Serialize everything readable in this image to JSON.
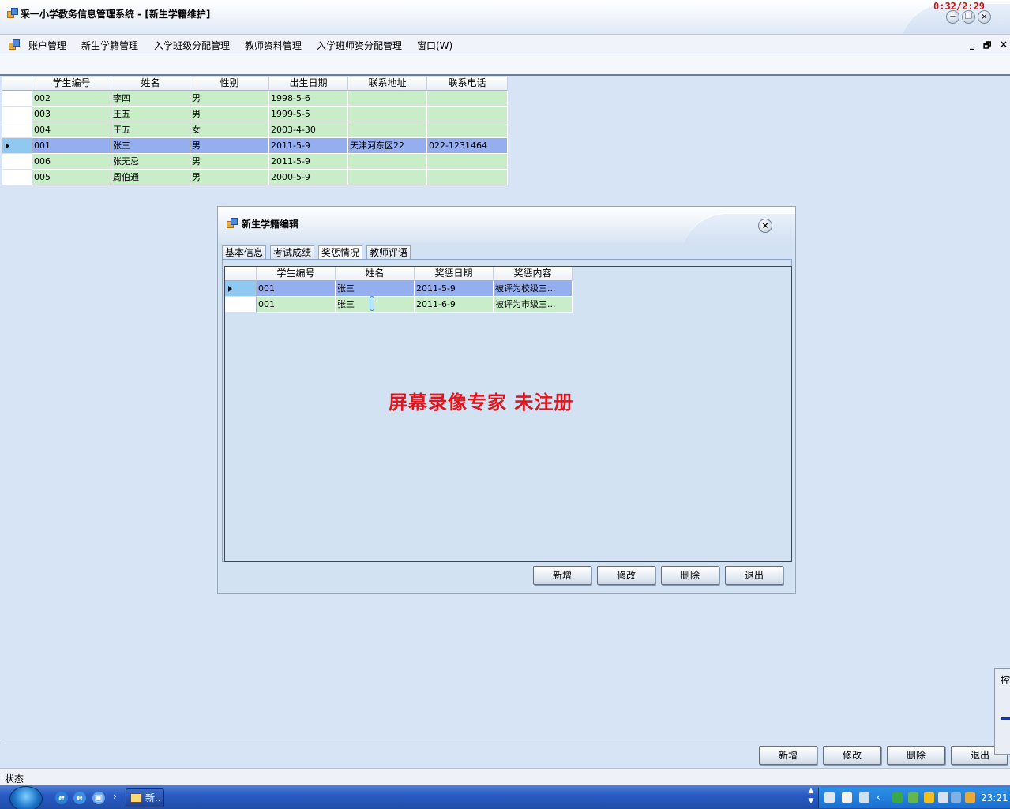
{
  "window": {
    "title": "采一小学教务信息管理系统 - [新生学籍维护]",
    "recorder_time": "0:32/2:29",
    "minimize_glyph": "−",
    "restore_glyph": "❐",
    "close_glyph": "×"
  },
  "menu": {
    "items": [
      "账户管理",
      "新生学籍管理",
      "入学班级分配管理",
      "教师资料管理",
      "入学班师资分配管理",
      "窗口(W)"
    ],
    "mdi_controls": [
      "_",
      "🗗",
      "×"
    ]
  },
  "main_grid": {
    "columns": [
      "学生编号",
      "姓名",
      "性别",
      "出生日期",
      "联系地址",
      "联系电话"
    ],
    "rows": [
      [
        "002",
        "李四",
        "男",
        "1998-5-6",
        "",
        ""
      ],
      [
        "003",
        "王五",
        "男",
        "1999-5-5",
        "",
        ""
      ],
      [
        "004",
        "王五",
        "女",
        "2003-4-30",
        "",
        ""
      ],
      [
        "001",
        "张三",
        "男",
        "2011-5-9",
        "天津河东区22",
        "022-1231464"
      ],
      [
        "006",
        "张无忌",
        "男",
        "2011-5-9",
        "",
        ""
      ],
      [
        "005",
        "周伯通",
        "男",
        "2000-5-9",
        "",
        ""
      ]
    ],
    "selected_row": 3
  },
  "dialog": {
    "title": "新生学籍编辑",
    "close_glyph": "×",
    "tabs": [
      "基本信息",
      "考试成绩",
      "奖惩情况",
      "教师评语"
    ],
    "active_tab": 2,
    "grid": {
      "columns": [
        "学生编号",
        "姓名",
        "奖惩日期",
        "奖惩内容"
      ],
      "rows": [
        [
          "001",
          "张三",
          "2011-5-9",
          "被评为校级三..."
        ],
        [
          "001",
          "张三",
          "2011-6-9",
          "被评为市级三..."
        ]
      ],
      "selected_row": 0
    },
    "buttons": {
      "add": "新增",
      "edit": "修改",
      "delete": "删除",
      "exit": "退出"
    }
  },
  "watermark": "屏幕录像专家  未注册",
  "bottom_buttons": {
    "add": "新增",
    "edit": "修改",
    "delete": "删除",
    "exit": "退出"
  },
  "side_panel_label": "控",
  "status_text": "状态",
  "taskbar": {
    "task_label": "新..",
    "clock": "23:21",
    "chevron": "›"
  },
  "colors": {
    "row_green": "#c8edc8",
    "row_selected": "#94aef0",
    "watermark_red": "#e0141c",
    "mdi_background": "#d6e4f5"
  }
}
